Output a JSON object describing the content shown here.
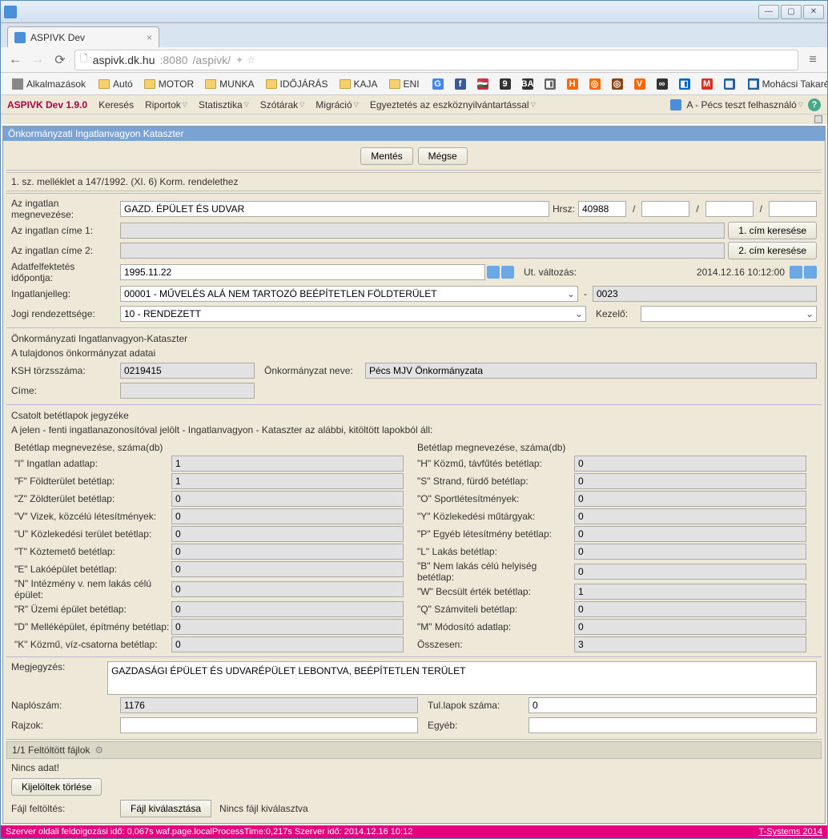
{
  "window": {
    "title": "ASPIVK Dev"
  },
  "url": {
    "host": "aspivk.dk.hu",
    "port": ":8080",
    "path": "/aspivk/"
  },
  "bookmarks": {
    "apps": "Alkalmazások",
    "items": [
      {
        "type": "folder",
        "label": "Autó"
      },
      {
        "type": "folder",
        "label": "MOTOR"
      },
      {
        "type": "folder",
        "label": "MUNKA"
      },
      {
        "type": "folder",
        "label": "IDŐJÁRÁS"
      },
      {
        "type": "folder",
        "label": "KAJA"
      },
      {
        "type": "folder",
        "label": "ENI"
      }
    ],
    "icons": [
      "G",
      "f",
      "🇭🇺",
      "9",
      "BA",
      "◧",
      "H",
      "◎",
      "◎",
      "V",
      "∞",
      "◧",
      "M",
      "▦"
    ],
    "bank": "Mohácsi Takarék Bank ..."
  },
  "appbar": {
    "title": "ASPIVK Dev 1.9.0",
    "menu": [
      "Keresés",
      "Riportok",
      "Statisztika",
      "Szótárak",
      "Migráció",
      "Egyeztetés az eszköznyilvántartással"
    ],
    "dropdown_indices": [
      1,
      2,
      3,
      4,
      5
    ],
    "user": "A - Pécs teszt felhasználó"
  },
  "panel": {
    "title": "Önkormányzati Ingatlanvagyon Kataszter",
    "save": "Mentés",
    "cancel": "Mégse",
    "section1": "1. sz. melléklet a 147/1992. (XI. 6) Korm. rendelethez",
    "fields": {
      "name_label": "Az ingatlan megnevezése:",
      "name_value": "GAZD. ÉPÜLET ÉS UDVAR",
      "hrsz_label": "Hrsz:",
      "hrsz_value": "40988",
      "addr1_label": "Az ingatlan címe 1:",
      "addr1_btn": "1. cím keresése",
      "addr2_label": "Az ingatlan címe 2:",
      "addr2_btn": "2. cím keresése",
      "date_label": "Adatfelfektetés időpontja:",
      "date_value": "1995.11.22",
      "change_label": "Ut. változás:",
      "change_value": "2014.12.16 10:12:00",
      "type_label": "Ingatlanjelleg:",
      "type_value": "00001 - MŰVELÉS ALÁ NEM TARTOZÓ BEÉPÍTETLEN FÖLDTERÜLET",
      "dash": "-",
      "code_value": "0023",
      "legal_label": "Jogi rendezettsége:",
      "legal_value": "10 - RENDEZETT",
      "kezelo_label": "Kezelő:"
    },
    "owner": {
      "header": "Önkormányzati Ingatlanvagyon-Kataszter",
      "sub": "A tulajdonos önkormányzat adatai",
      "ksh_label": "KSH törzsszáma:",
      "ksh_value": "0219415",
      "onk_label": "Önkormányzat neve:",
      "onk_value": "Pécs MJV Önkormányzata",
      "cime_label": "Címe:"
    },
    "sheets": {
      "header": "Csatolt betétlapok jegyzéke",
      "sub": "A jelen - fenti ingatlanazonosítóval jelölt - Ingatlanvagyon - Kataszter az alábbi, kitöltött lapokból áll:",
      "col_header": "Betétlap megnevezése, száma(db)",
      "left": [
        {
          "label": "\"I\" Ingatlan adatlap:",
          "value": "1"
        },
        {
          "label": "\"F\" Földterület betétlap:",
          "value": "1"
        },
        {
          "label": "\"Z\" Zöldterület betétlap:",
          "value": "0"
        },
        {
          "label": "\"V\" Vizek, közcélú létesítmények:",
          "value": "0"
        },
        {
          "label": "\"U\" Közlekedési terület betétlap:",
          "value": "0"
        },
        {
          "label": "\"T\" Köztemető betétlap:",
          "value": "0"
        },
        {
          "label": "\"E\" Lakóépület betétlap:",
          "value": "0"
        },
        {
          "label": "\"N\" Intézmény v. nem lakás célú épület:",
          "value": "0"
        },
        {
          "label": "\"R\" Üzemi épület betétlap:",
          "value": "0"
        },
        {
          "label": "\"D\" Melléképület, építmény betétlap:",
          "value": "0"
        },
        {
          "label": "\"K\" Közmű, víz-csatorna betétlap:",
          "value": "0"
        }
      ],
      "right": [
        {
          "label": "\"H\" Közmű, távfűtés betétlap:",
          "value": "0"
        },
        {
          "label": "\"S\" Strand, fürdő betétlap:",
          "value": "0"
        },
        {
          "label": "\"O\" Sportlétesítmények:",
          "value": "0"
        },
        {
          "label": "\"Y\" Közlekedési műtárgyak:",
          "value": "0"
        },
        {
          "label": "\"P\" Egyéb létesítmény betétlap:",
          "value": "0"
        },
        {
          "label": "\"L\" Lakás betétlap:",
          "value": "0"
        },
        {
          "label": "\"B\" Nem lakás célú helyiség betétlap:",
          "value": "0"
        },
        {
          "label": "\"W\" Becsült érték betétlap:",
          "value": "1"
        },
        {
          "label": "\"Q\" Számviteli betétlap:",
          "value": "0"
        },
        {
          "label": "\"M\" Módosító adatlap:",
          "value": "0"
        },
        {
          "label": "Összesen:",
          "value": "3"
        }
      ]
    },
    "notes": {
      "label": "Megjegyzés:",
      "value": "GAZDASÁGI ÉPÜLET ÉS UDVARÉPÜLET LEBONTVA, BEÉPÍTETLEN TERÜLET",
      "naplo_label": "Naplószám:",
      "naplo_value": "1176",
      "tul_label": "Tul.lapok száma:",
      "tul_value": "0",
      "rajzok_label": "Rajzok:",
      "egyeb_label": "Egyéb:"
    },
    "files": {
      "header": "1/1  Feltöltött fájlok",
      "nodata": "Nincs adat!",
      "delete_btn": "Kijelöltek törlése",
      "upload_label": "Fájl feltöltés:",
      "choose_btn": "Fájl kiválasztása",
      "nofile": "Nincs fájl kiválasztva"
    }
  },
  "status": {
    "left": "Szerver oldali feldolgozási idő: 0,067s waf.page.localProcessTime:0,217s   Szerver idő: 2014.12.16 10:12",
    "right": "T-Systems 2014"
  }
}
